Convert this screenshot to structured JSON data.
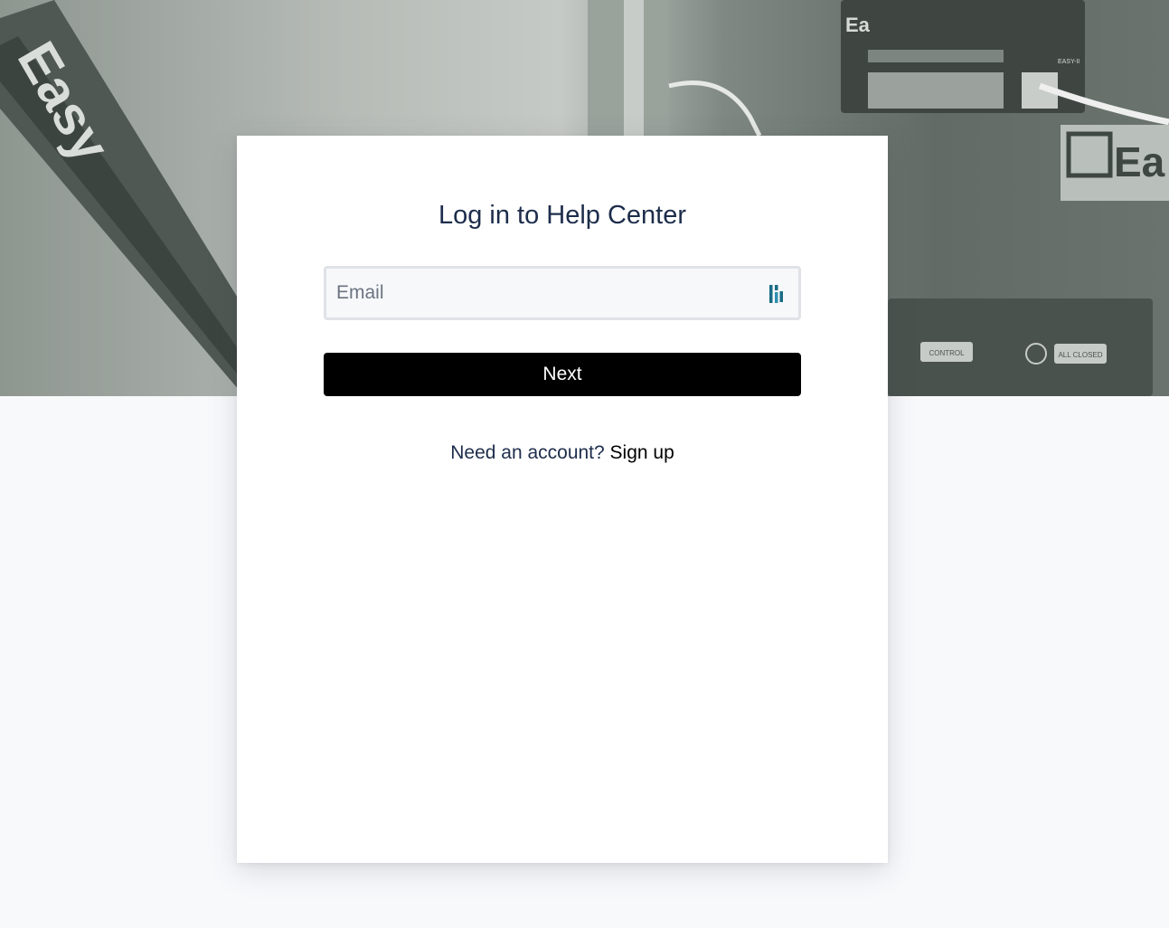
{
  "page": {
    "title": "Log in to Help Center"
  },
  "form": {
    "email_placeholder": "Email",
    "email_value": "",
    "next_label": "Next"
  },
  "signup": {
    "prompt": "Need an account?",
    "link_label": "Sign up"
  },
  "background": {
    "device_text_1": "Easy",
    "device_text_2": "Ea",
    "device_text_3": "Ea",
    "button_label_control": "CONTROL",
    "button_label_all_closed": "ALL CLOSED",
    "model_label": "EASY-II"
  },
  "icons": {
    "password_manager": "password-manager-icon"
  },
  "colors": {
    "title": "#1d2d4b",
    "button_bg": "#000000",
    "button_text": "#ffffff",
    "page_bg": "#f8f9fb",
    "icon_accent": "#1a6b86"
  }
}
